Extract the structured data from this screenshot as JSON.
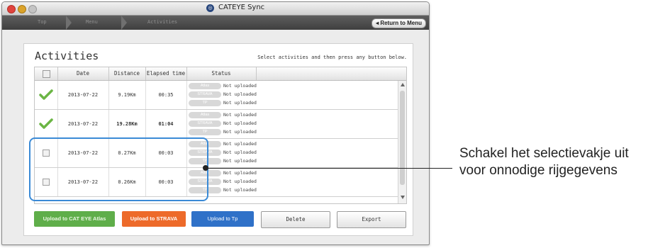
{
  "window": {
    "title": "CATEYE Sync",
    "app_icon_glyph": "◎"
  },
  "nav": {
    "crumbs": [
      "Top",
      "Menu",
      "Activities"
    ],
    "return_label": "◂ Return to Menu"
  },
  "panel": {
    "title": "Activities",
    "instruction": "Select activities and then press any button below."
  },
  "table": {
    "columns": [
      "Date",
      "Distance",
      "Elapsed time",
      "Status"
    ],
    "rows": [
      {
        "selected": true,
        "date": "2013-07-22",
        "distance": "9.19Km",
        "elapsed": "00:35",
        "status": [
          {
            "service": "Atlas",
            "text": "Not uploaded"
          },
          {
            "service": "STRAVA",
            "text": "Not uploaded"
          },
          {
            "service": "TP",
            "text": "Not uploaded"
          }
        ]
      },
      {
        "selected": true,
        "date": "2013-07-22",
        "distance": "19.28Km",
        "elapsed": "01:04",
        "status": [
          {
            "service": "Atlas",
            "text": "Not uploaded"
          },
          {
            "service": "STRAVA",
            "text": "Not uploaded"
          },
          {
            "service": "TP",
            "text": "Not uploaded"
          }
        ]
      },
      {
        "selected": false,
        "date": "2013-07-22",
        "distance": "0.27Km",
        "elapsed": "00:03",
        "status": [
          {
            "service": "Atlas",
            "text": "Not uploaded"
          },
          {
            "service": "STRAVA",
            "text": "Not uploaded"
          },
          {
            "service": "TP",
            "text": "Not uploaded"
          }
        ]
      },
      {
        "selected": false,
        "date": "2013-07-22",
        "distance": "0.26Km",
        "elapsed": "00:03",
        "status": [
          {
            "service": "Atlas",
            "text": "Not uploaded"
          },
          {
            "service": "STRAVA",
            "text": "Not uploaded"
          },
          {
            "service": "TP",
            "text": "Not uploaded"
          }
        ]
      }
    ]
  },
  "buttons": {
    "cateye": "Upload to CAT EYE Atlas",
    "strava": "Upload to STRAVA",
    "tp": "Upload to Tp",
    "delete": "Delete",
    "export": "Export"
  },
  "annotation": {
    "text_line1": "Schakel het selectievakje uit",
    "text_line2": "voor onnodige rijgegevens"
  },
  "colors": {
    "check": "#6bb544",
    "cateye_btn": "#5fae4a",
    "strava_btn": "#ed6a2a",
    "tp_btn": "#2f71c8",
    "highlight": "#3a8ad6"
  }
}
